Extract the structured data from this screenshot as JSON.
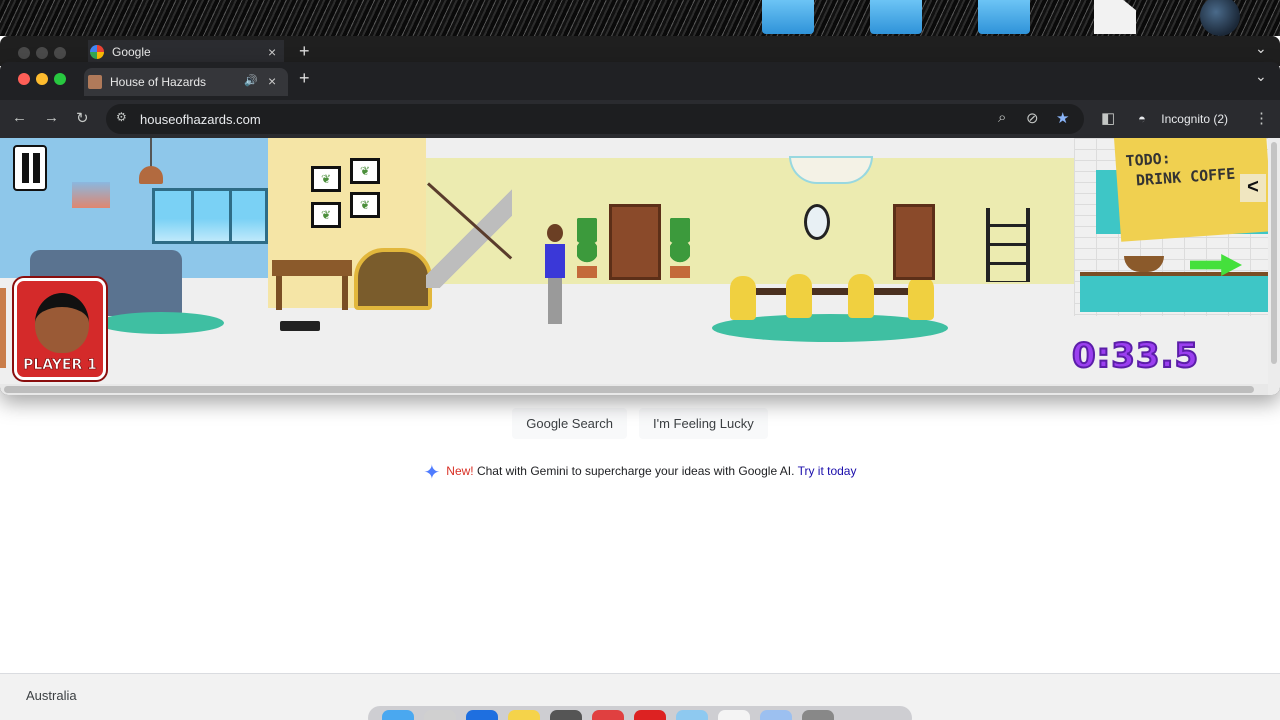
{
  "back_window": {
    "tab_title": "Google",
    "search_button": "Google Search",
    "lucky_button": "I'm Feeling Lucky",
    "promo": {
      "new_label": "New!",
      "text": " Chat with Gemini to supercharge your ideas with Google AI. ",
      "link": "Try it today"
    },
    "footer_country": "Australia"
  },
  "front_window": {
    "tab_title": "House of Hazards",
    "url": "houseofhazards.com",
    "incognito_label": "Incognito (2)",
    "game": {
      "sticky_note": "TODO:\n DRINK COFFE",
      "timer": "0:33.5",
      "player_label": "PLAYER 1",
      "collapse_glyph": "<"
    }
  },
  "icons": {
    "close": "×",
    "new_tab": "+",
    "back": "←",
    "forward": "→",
    "reload": "↻",
    "zoom": "⌕",
    "eye_off": "⊘",
    "star": "★",
    "side_panel": "◧",
    "menu": "⋮",
    "speaker": "🔊",
    "gemini_star": "✦",
    "tab_down": "⌄"
  },
  "colors": {
    "browser_dark": "#202124",
    "timer": "#9b3ff0",
    "player_card": "#d42a2a",
    "star": "#8ab4f8"
  }
}
